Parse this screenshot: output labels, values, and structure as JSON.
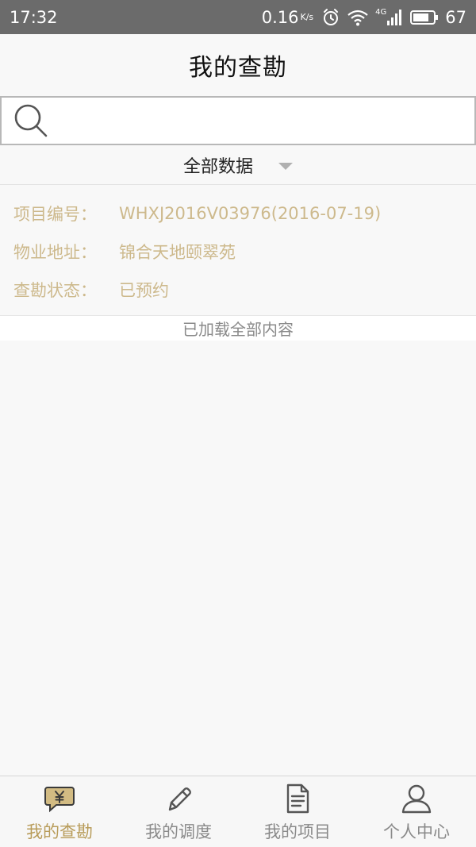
{
  "status_bar": {
    "time": "17:32",
    "speed": "0.16",
    "speed_unit": "K/s",
    "network": "4G",
    "battery": "67"
  },
  "header": {
    "title": "我的查勘"
  },
  "search": {
    "value": "",
    "placeholder": ""
  },
  "filter": {
    "selected": "全部数据"
  },
  "record": {
    "project_label": "项目编号：",
    "project_value": "WHXJ2016V03976(2016-07-19)",
    "address_label": "物业地址：",
    "address_value": "锦合天地颐翠苑",
    "status_label": "查勘状态：",
    "status_value": "已预约"
  },
  "list": {
    "end_message": "已加载全部内容"
  },
  "tabs": [
    {
      "label": "我的查勘",
      "icon": "yuan-chat-icon",
      "active": true
    },
    {
      "label": "我的调度",
      "icon": "pencil-icon",
      "active": false
    },
    {
      "label": "我的项目",
      "icon": "document-icon",
      "active": false
    },
    {
      "label": "个人中心",
      "icon": "person-icon",
      "active": false
    }
  ],
  "colors": {
    "status_bar_bg": "#6b6b6b",
    "accent_gold": "#b89c5a",
    "record_text": "#cdb98c",
    "icon_gray": "#8a8a8a"
  }
}
